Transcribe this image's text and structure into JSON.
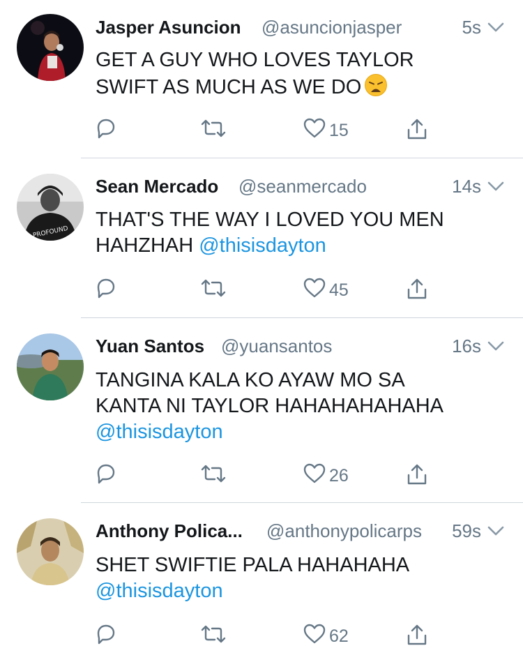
{
  "tweets": [
    {
      "name": "Jasper Asuncion",
      "handle": "@asuncionjasper",
      "time": "5s",
      "lines": [
        {
          "text": "GET A GUY WHO LOVES TAYLOR",
          "mention": ""
        },
        {
          "text": "SWIFT AS MUCH AS WE DO",
          "mention": ""
        }
      ],
      "emoji": "weary-face-emoji",
      "likes": "15"
    },
    {
      "name": "Sean Mercado",
      "handle": "@seanmercado",
      "time": "14s",
      "lines": [
        {
          "text": "THAT'S THE WAY I LOVED YOU MEN",
          "mention": ""
        },
        {
          "text": "HAHZHAH ",
          "mention": "@thisisdayton"
        }
      ],
      "likes": "45"
    },
    {
      "name": "Yuan Santos",
      "handle": "@yuansantos",
      "time": "16s",
      "lines": [
        {
          "text": "TANGINA KALA KO AYAW MO SA",
          "mention": ""
        },
        {
          "text": "KANTA NI TAYLOR HAHAHAHAHAHA",
          "mention": ""
        },
        {
          "text": "",
          "mention": "@thisisdayton"
        }
      ],
      "likes": "26"
    },
    {
      "name": "Anthony Polica...",
      "handle": "@anthonypolicarps",
      "time": "59s",
      "lines": [
        {
          "text": "SHET SWIFTIE PALA HAHAHAHA",
          "mention": ""
        },
        {
          "text": "",
          "mention": "@thisisdayton"
        }
      ],
      "likes": "62"
    }
  ],
  "icons": {
    "reply": "reply-icon",
    "retweet": "retweet-icon",
    "like": "heart-icon",
    "share": "share-icon",
    "more": "chevron-down-icon"
  },
  "colors": {
    "text": "#14171a",
    "secondary": "#657786",
    "link": "#1b95e0",
    "divider": "#cfd6dc"
  }
}
